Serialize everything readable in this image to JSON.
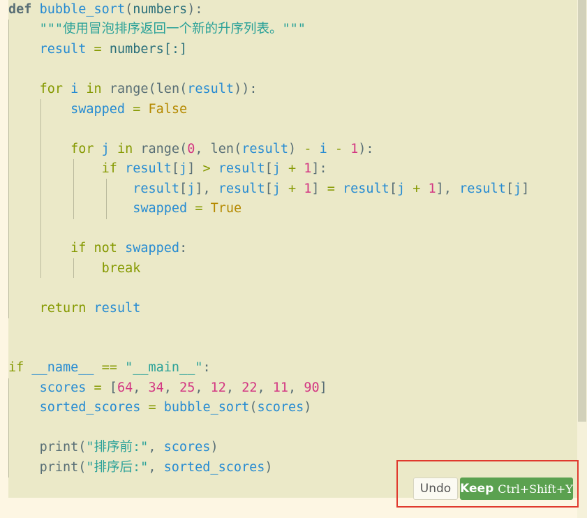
{
  "code": {
    "def_kw": "def",
    "func_name": "bubble_sort",
    "param": "numbers",
    "docstring": "\"\"\"使用冒泡排序返回一个新的升序列表。\"\"\"",
    "result_var": "result",
    "numbers_slice": "numbers[:]",
    "for_kw": "for",
    "in_kw": "in",
    "range_fn": "range",
    "len_fn": "len",
    "i_var": "i",
    "j_var": "j",
    "swapped_var": "swapped",
    "false_const": "False",
    "true_const": "True",
    "zero": "0",
    "one": "1",
    "if_kw": "if",
    "not_kw": "not",
    "break_kw": "break",
    "return_kw": "return",
    "name_dunder": "__name__",
    "main_str": "\"__main__\"",
    "scores_var": "scores",
    "scores_values": [
      "64",
      "34",
      "25",
      "12",
      "22",
      "11",
      "90"
    ],
    "sorted_scores_var": "sorted_scores",
    "print_fn": "print",
    "before_str": "\"排序前:\"",
    "after_str": "\"排序后:\""
  },
  "inline_actions": {
    "undo_label": "Undo",
    "keep_label": "Keep",
    "keep_shortcut": "Ctrl+Shift+Y"
  }
}
